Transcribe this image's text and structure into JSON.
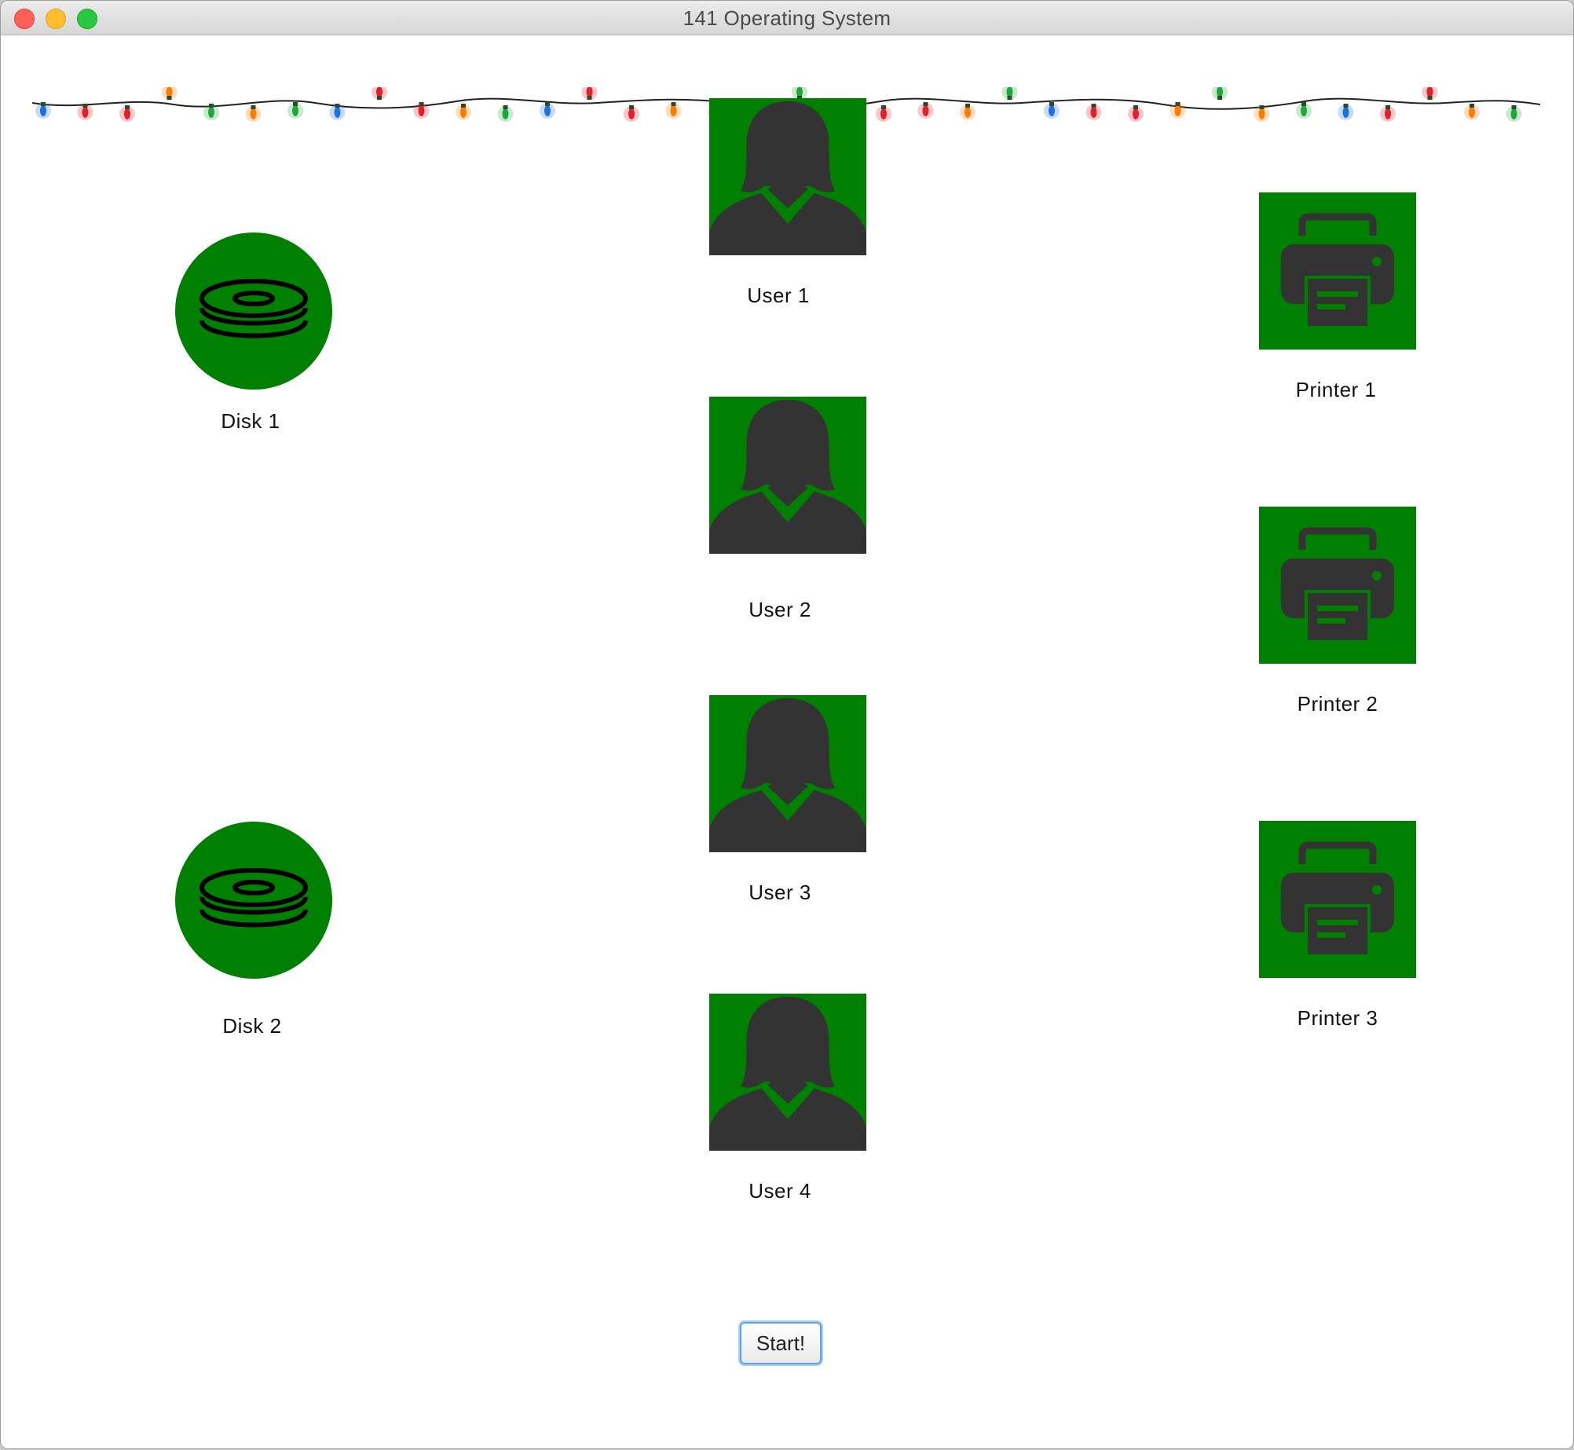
{
  "window": {
    "title": "141 Operating System"
  },
  "disks": [
    {
      "label": "Disk 1",
      "icon": "disk-icon"
    },
    {
      "label": "Disk 2",
      "icon": "disk-icon"
    }
  ],
  "users": [
    {
      "label": "User 1",
      "icon": "user-icon"
    },
    {
      "label": "User 2",
      "icon": "user-icon"
    },
    {
      "label": "User 3",
      "icon": "user-icon"
    },
    {
      "label": "User 4",
      "icon": "user-icon"
    }
  ],
  "printers": [
    {
      "label": "Printer 1",
      "icon": "printer-icon"
    },
    {
      "label": "Printer 2",
      "icon": "printer-icon"
    },
    {
      "label": "Printer 3",
      "icon": "printer-icon"
    }
  ],
  "start_button": {
    "label": "Start!"
  },
  "colors": {
    "resource_bg": "#008000",
    "icon_dark": "#333333",
    "button_focus": "#5aa3e8"
  },
  "decoration": {
    "string_lights": "christmas-lights-garland"
  }
}
